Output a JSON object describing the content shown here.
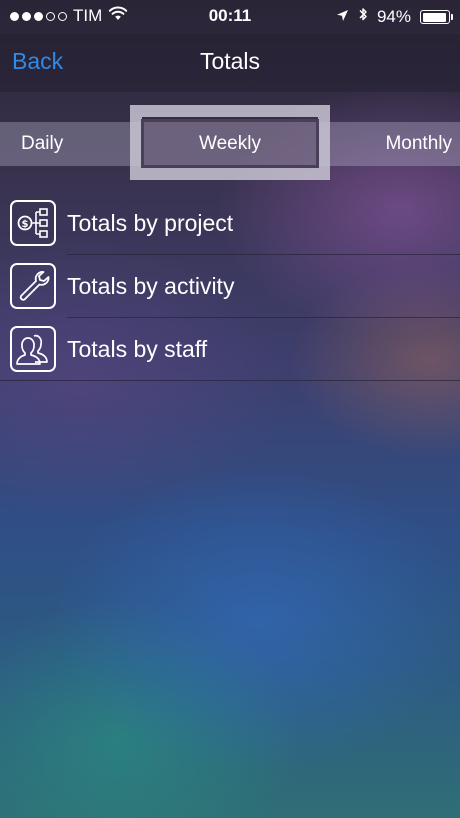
{
  "status_bar": {
    "carrier": "TIM",
    "time": "00:11",
    "battery_percent": "94%",
    "battery_level": 0.94,
    "signal_bars_filled": 3,
    "signal_bars_total": 5
  },
  "nav": {
    "back_label": "Back",
    "title": "Totals",
    "back_color": "#2f8ae8"
  },
  "segments": {
    "daily": "Daily",
    "weekly": "Weekly",
    "monthly": "Monthly",
    "selected": "weekly"
  },
  "list": {
    "items": [
      {
        "label": "Totals by project",
        "icon": "project-hierarchy-icon"
      },
      {
        "label": "Totals by activity",
        "icon": "wrench-icon"
      },
      {
        "label": "Totals by staff",
        "icon": "staff-people-icon"
      }
    ]
  }
}
